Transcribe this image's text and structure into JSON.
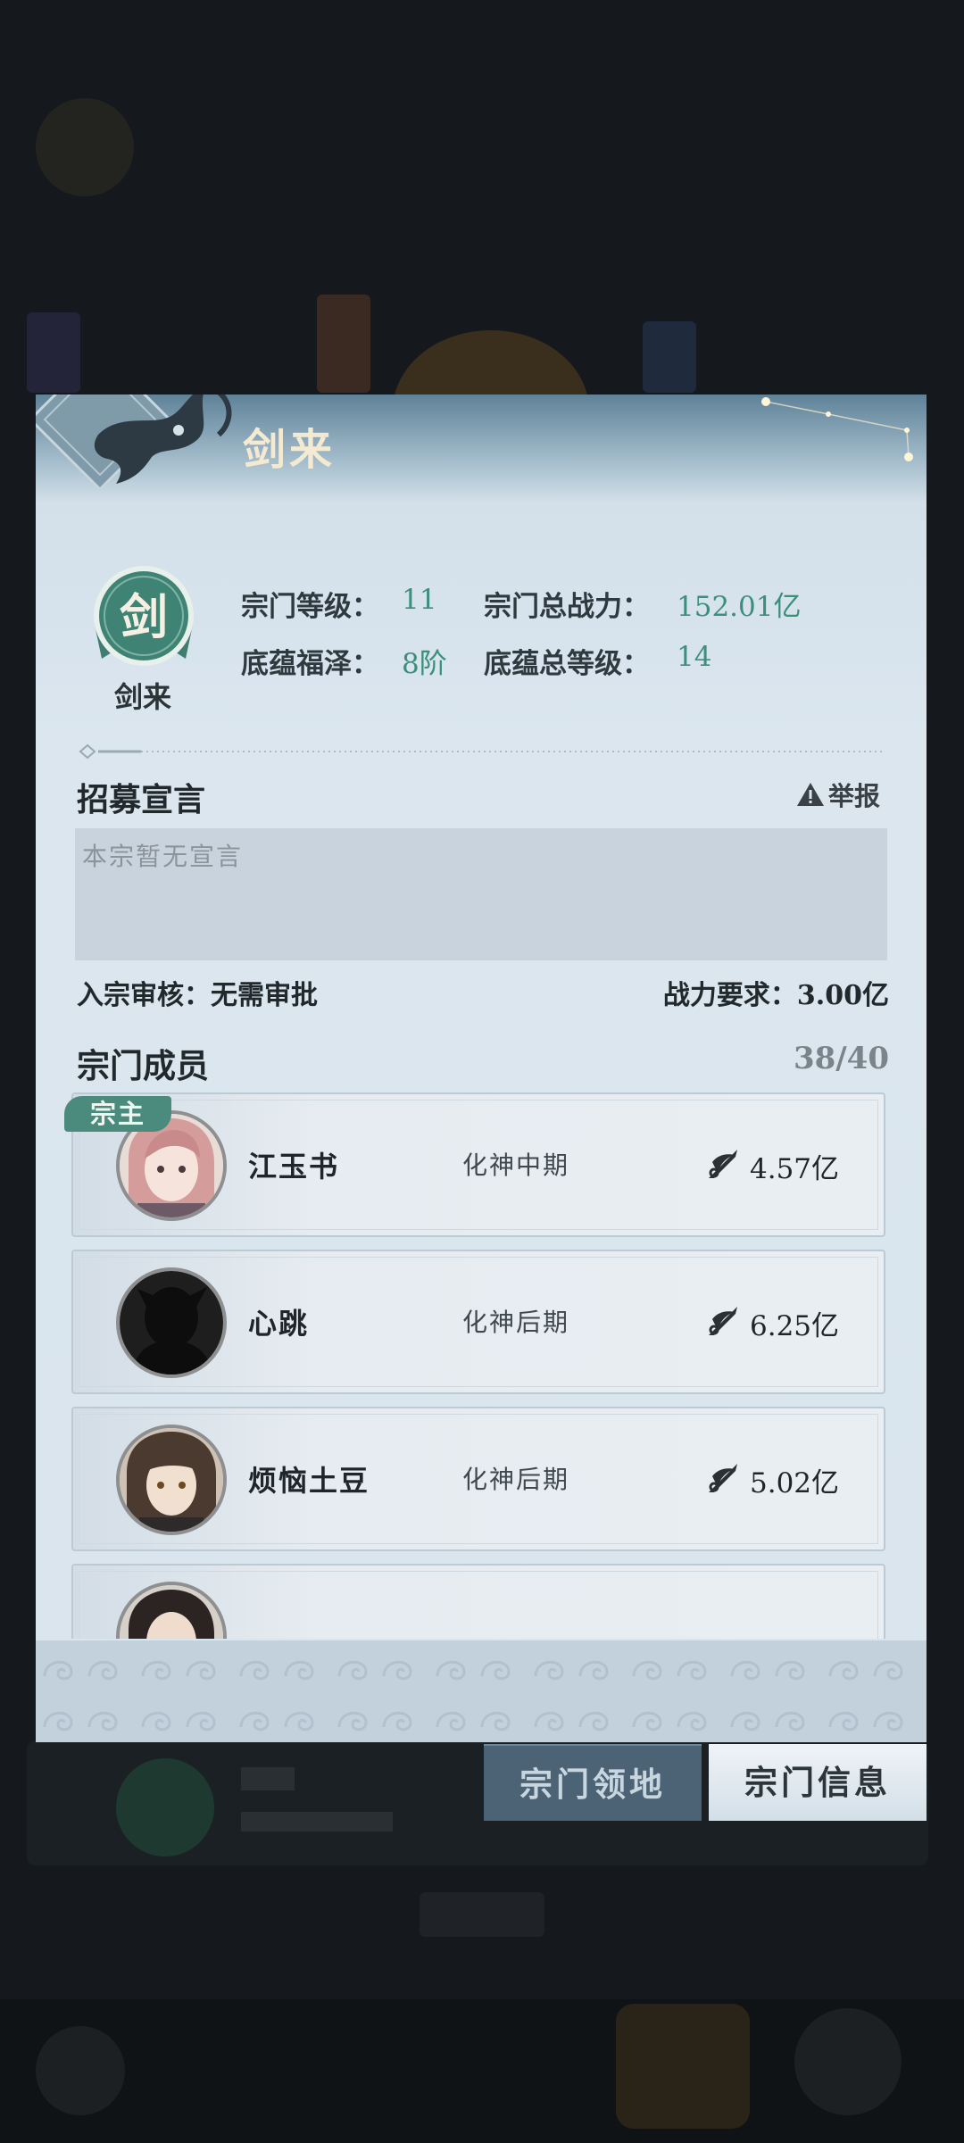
{
  "sect": {
    "title": "剑来",
    "badge_char": "剑",
    "badge_name": "剑来"
  },
  "info": {
    "level_label": "宗门等级：",
    "level_value": "11",
    "total_power_label": "宗门总战力：",
    "total_power_value": "152.01亿",
    "heritage_label": "底蕴福泽：",
    "heritage_value": "8阶",
    "heritage_total_label": "底蕴总等级：",
    "heritage_total_value": "14"
  },
  "recruit": {
    "title": "招募宣言",
    "report_label": "举报",
    "declaration": "本宗暂无宣言",
    "review_label": "入宗审核：无需审批",
    "power_req_label": "战力要求：3.00亿"
  },
  "members": {
    "title": "宗门成员",
    "count": "38/40",
    "leader_tag": "宗主",
    "list": [
      {
        "name": "江玉书",
        "realm": "化神中期",
        "power": "4.57亿"
      },
      {
        "name": "心跳",
        "realm": "化神后期",
        "power": "6.25亿"
      },
      {
        "name": "烦恼土豆",
        "realm": "化神后期",
        "power": "5.02亿"
      },
      {
        "name": "",
        "realm": "",
        "power": ""
      }
    ]
  },
  "tabs": {
    "territory": "宗门领地",
    "info": "宗门信息"
  },
  "colors": {
    "accent_green": "#3d8f7c",
    "leader_tag": "#4a8b7d"
  }
}
